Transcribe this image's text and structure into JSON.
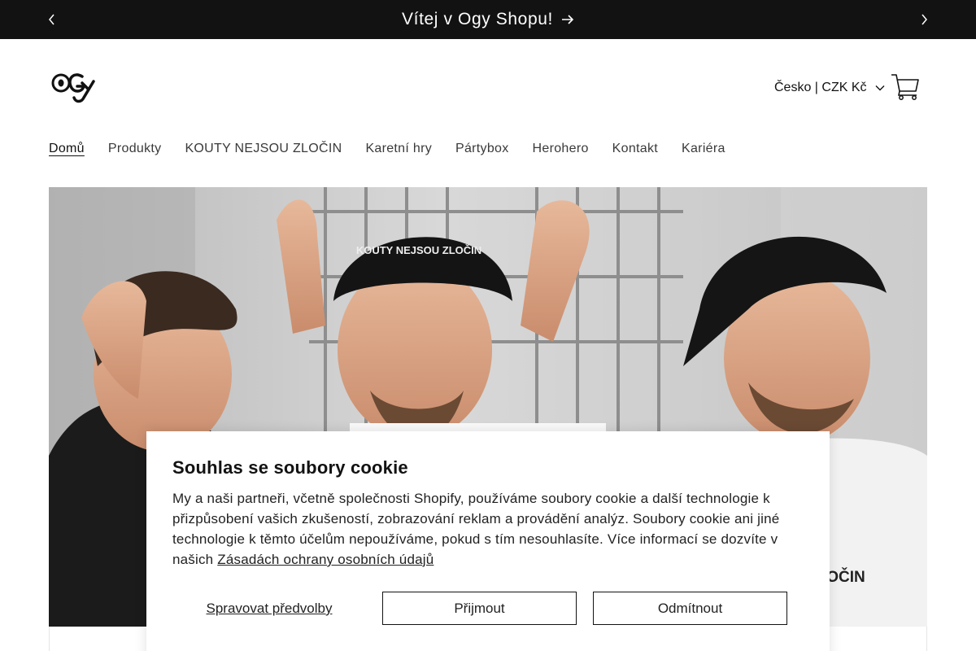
{
  "announcement": {
    "text": "Vítej v Ogy Shopu!",
    "prev_icon": "chevron-left-icon",
    "next_icon": "chevron-right-icon",
    "link_icon": "arrow-right-icon"
  },
  "header": {
    "logo_text": "OGY",
    "country_selector": "Česko | CZK Kč",
    "cart_icon": "cart-icon"
  },
  "nav": {
    "items": [
      {
        "label": "Domů",
        "active": true
      },
      {
        "label": "Produkty",
        "active": false
      },
      {
        "label": "KOUTY NEJSOU ZLOČIN",
        "active": false
      },
      {
        "label": "Karetní hry",
        "active": false
      },
      {
        "label": "Pártybox",
        "active": false
      },
      {
        "label": "Herohero",
        "active": false
      },
      {
        "label": "Kontakt",
        "active": false
      },
      {
        "label": "Kariéra",
        "active": false
      }
    ]
  },
  "hero": {
    "cap_text": "KOUTY NEJSOU ZLOČIN",
    "shirt_text": "OČIN"
  },
  "cookie_banner": {
    "title": "Souhlas se soubory cookie",
    "body": "My a naši partneři, včetně společnosti Shopify, používáme soubory cookie a další technologie k přizpůsobení vašich zkušeností, zobrazování reklam a provádění analýz. Soubory cookie ani jiné technologie k těmto účelům nepoužíváme, pokud s tím nesouhlasíte. Více informací se dozvíte v našich",
    "policy_link": "Zásadách ochrany osobních údajů",
    "manage_label": "Spravovat předvolby",
    "accept_label": "Přijmout",
    "decline_label": "Odmítnout"
  },
  "colors": {
    "announcement_bg": "#121212",
    "text": "#121212",
    "background": "#ffffff"
  }
}
